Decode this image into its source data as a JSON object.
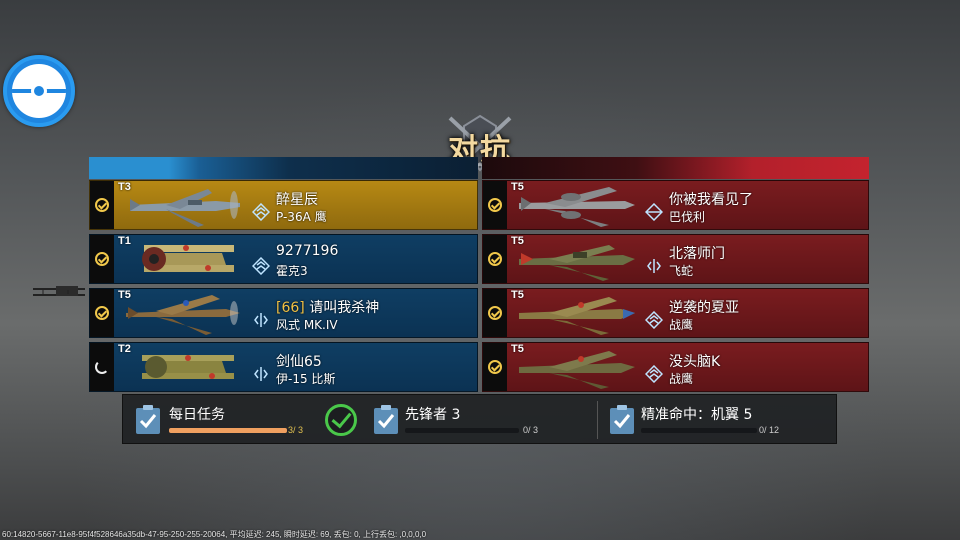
{
  "title": "对抗",
  "colors": {
    "blue_team": "#0f3e63",
    "red_team": "#7a1c1f",
    "highlight": "#b78914",
    "tier_check": "#f1c84b",
    "mission_done": "#4ac84a"
  },
  "blue_team": [
    {
      "tier": "T3",
      "player": "醉星辰",
      "tag": "",
      "aircraft": "P-36A 鹰",
      "status": "ready",
      "rank_icon": "chevron-rank-icon",
      "highlight": true
    },
    {
      "tier": "T1",
      "player": "9277196",
      "tag": "",
      "aircraft": "霍克3",
      "status": "ready",
      "rank_icon": "chevron-rank-icon",
      "highlight": false
    },
    {
      "tier": "T5",
      "player": "请叫我杀神",
      "tag": "[66]",
      "aircraft": "风式 MK.IV",
      "status": "ready",
      "rank_icon": "wing-rank-icon",
      "highlight": false
    },
    {
      "tier": "T2",
      "player": "剑仙65",
      "tag": "",
      "aircraft": "伊-15 比斯",
      "status": "loading",
      "rank_icon": "wing-rank-icon",
      "highlight": false
    }
  ],
  "red_team": [
    {
      "tier": "T5",
      "player": "你被我看见了",
      "aircraft": "巴伐利",
      "status": "ready",
      "rank_icon": "diamond-rank-icon"
    },
    {
      "tier": "T5",
      "player": "北落师门",
      "aircraft": "飞蛇",
      "status": "ready",
      "rank_icon": "wing-rank-icon"
    },
    {
      "tier": "T5",
      "player": "逆袭的夏亚",
      "aircraft": "战鹰",
      "status": "ready",
      "rank_icon": "chevron-rank-icon"
    },
    {
      "tier": "T5",
      "player": "没头脑K",
      "aircraft": "战鹰",
      "status": "ready",
      "rank_icon": "chevron-rank-icon"
    }
  ],
  "missions": [
    {
      "title": "每日任务",
      "progress": "3/ 3",
      "fraction": 1.0,
      "icon": "clipboard-check-icon",
      "completed": true
    },
    {
      "title": "先锋者 3",
      "progress": "0/ 3",
      "fraction": 0.0,
      "icon": "clipboard-check-icon",
      "completed": false
    },
    {
      "title": "精准命中：机翼 5",
      "progress": "0/ 12",
      "fraction": 0.0,
      "icon": "clipboard-check-icon",
      "completed": false
    }
  ],
  "debug_text": "60:14820-5667-11e8-95f4f528646a35db-47-95-250-255-20064, 平均延迟: 245, 瞬时延迟: 69, 丢包: 0, 上行丢包: ,0,0,0,0"
}
